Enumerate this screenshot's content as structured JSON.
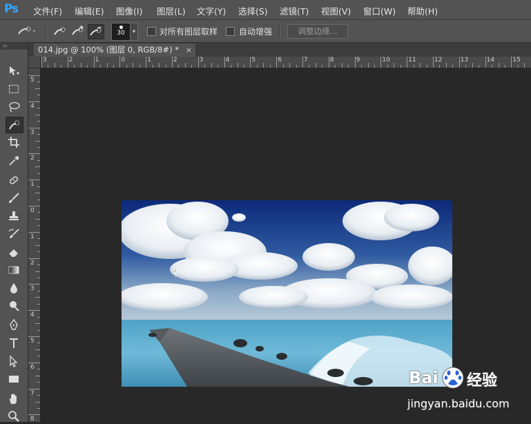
{
  "app": {
    "logo": "Ps"
  },
  "menu": {
    "items": [
      "文件(F)",
      "编辑(E)",
      "图像(I)",
      "图层(L)",
      "文字(Y)",
      "选择(S)",
      "滤镜(T)",
      "视图(V)",
      "窗口(W)",
      "帮助(H)"
    ]
  },
  "options": {
    "brush_size": "30",
    "sample_all_layers_label": "对所有图层取样",
    "auto_enhance_label": "自动增强",
    "refine_edge_label": "调整边缘...",
    "tool_icons": [
      "quick-selection-icon",
      "new-selection-icon",
      "add-to-selection-icon",
      "subtract-from-selection-icon"
    ]
  },
  "document": {
    "tab_title": "014.jpg @ 100% (图层 0, RGB/8#) *",
    "close_glyph": "×"
  },
  "toolbox": {
    "collapse_glyph": "››",
    "tools": [
      "move-tool-icon",
      "marquee-tool-icon",
      "lasso-tool-icon",
      "quick-selection-tool-icon",
      "crop-tool-icon",
      "eyedropper-tool-icon",
      "healing-brush-tool-icon",
      "brush-tool-icon",
      "clone-stamp-tool-icon",
      "history-brush-tool-icon",
      "eraser-tool-icon",
      "gradient-tool-icon",
      "blur-tool-icon",
      "dodge-tool-icon",
      "pen-tool-icon",
      "type-tool-icon",
      "path-selection-tool-icon",
      "rectangle-tool-icon",
      "hand-tool-icon",
      "zoom-tool-icon"
    ]
  },
  "ruler": {
    "top_labels": [
      "3",
      "2",
      "1",
      "0",
      "1",
      "2",
      "3",
      "4",
      "5",
      "6",
      "7",
      "8",
      "9",
      "10",
      "11",
      "12",
      "13",
      "14",
      "15"
    ],
    "left_labels": [
      "5",
      "4",
      "3",
      "2",
      "1",
      "0",
      "1",
      "2",
      "3",
      "4",
      "5",
      "6",
      "7",
      "8"
    ]
  },
  "watermark": {
    "brand_prefix": "Bai",
    "brand_suffix": "经验",
    "url": "jingyan.baidu.com"
  },
  "colors": {
    "menubar_bg": "#535353",
    "canvas_bg": "#282828",
    "ps_blue": "#31a8ff"
  }
}
